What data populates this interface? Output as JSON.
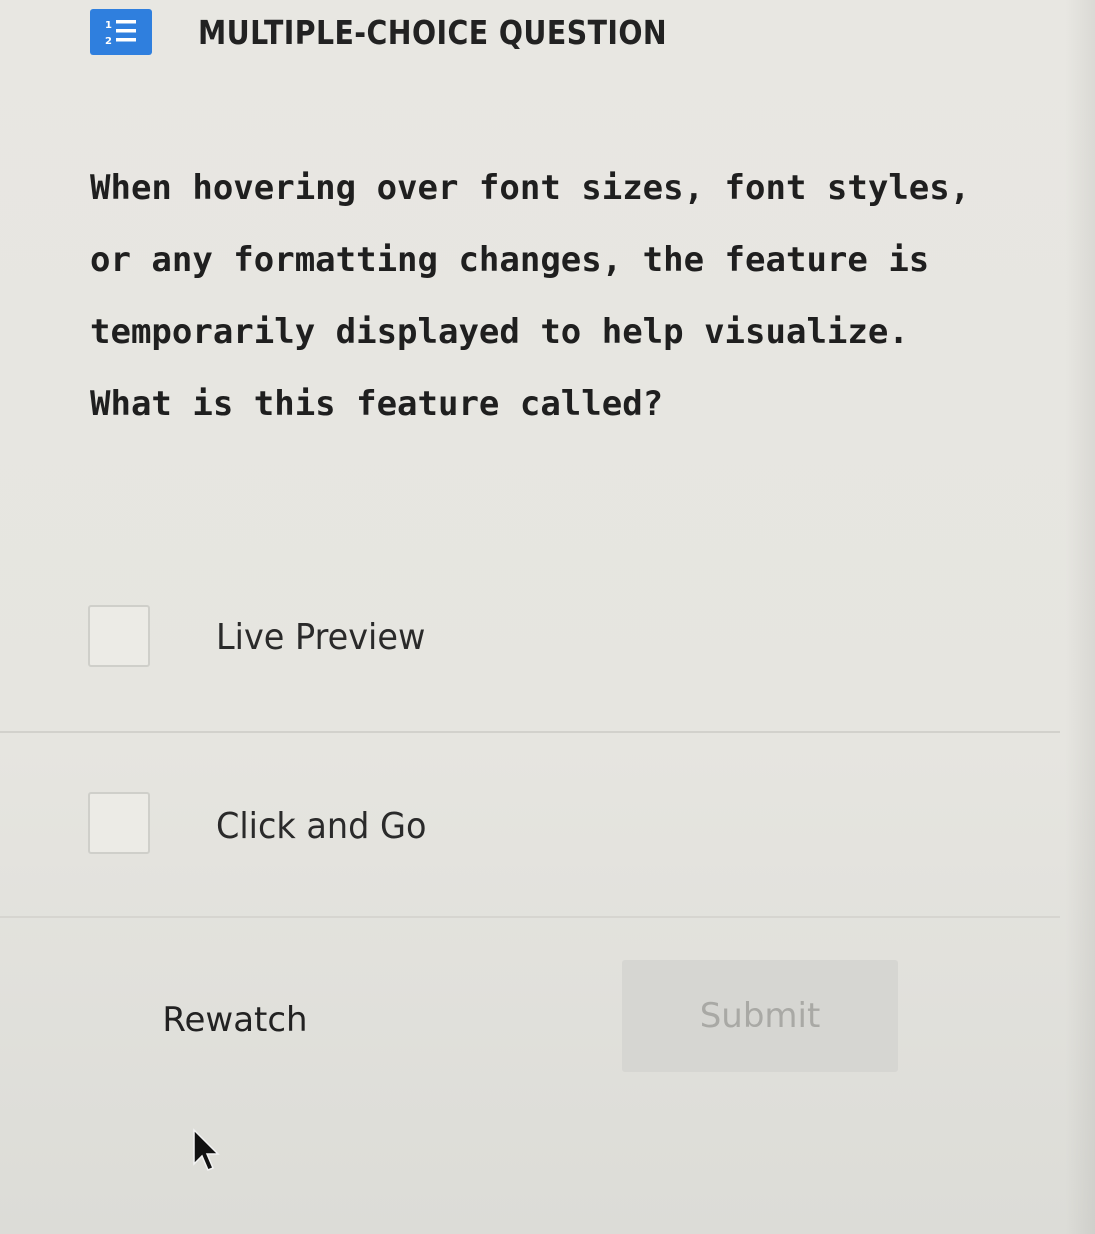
{
  "header": {
    "icon": "numbered-list-icon",
    "title": "MULTIPLE-CHOICE QUESTION",
    "accent_color": "#2f7fde"
  },
  "question": {
    "text": "When hovering over font sizes, font styles, or any formatting changes, the feature is temporarily displayed to help visualize. What is this feature called?"
  },
  "choices": [
    {
      "label": "Live Preview",
      "checked": false
    },
    {
      "label": "Click and Go",
      "checked": false
    }
  ],
  "actions": {
    "rewatch_label": "Rewatch",
    "submit_label": "Submit",
    "submit_enabled": false
  }
}
